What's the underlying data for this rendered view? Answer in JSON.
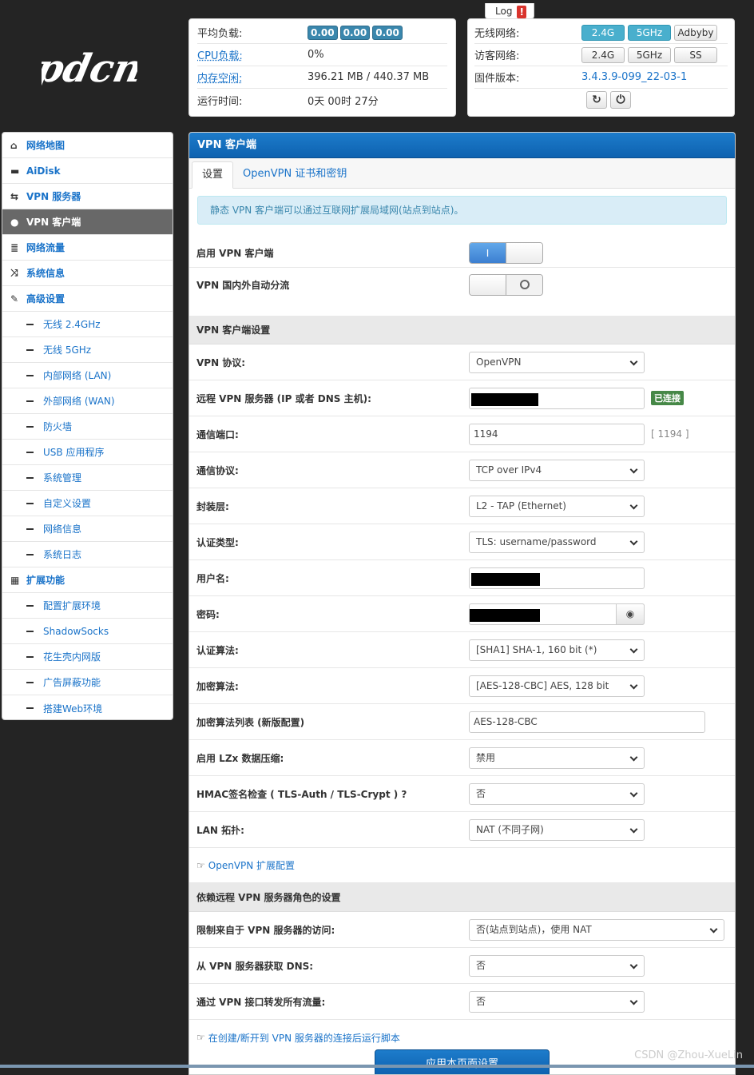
{
  "logo": {
    "text": "pdcn"
  },
  "log_tab": {
    "label": "Log",
    "warn": "!"
  },
  "status": {
    "load_label": "平均负载:",
    "load_values": [
      "0.00",
      "0.00",
      "0.00"
    ],
    "cpu_label": "CPU负载:",
    "cpu_value": "0%",
    "mem_label": "内存空闲:",
    "mem_value": "396.21 MB / 440.37 MB",
    "uptime_label": "运行时间:",
    "uptime_value": "0天 00时 27分"
  },
  "wifi": {
    "wireless_label": "无线网络:",
    "wireless_buttons": [
      "2.4G",
      "5GHz",
      "Adbyby"
    ],
    "guest_label": "访客网络:",
    "guest_buttons": [
      "2.4G",
      "5GHz",
      "SS"
    ],
    "firmware_label": "固件版本:",
    "firmware_value": "3.4.3.9-099_22-03-1"
  },
  "sidebar": {
    "items": [
      {
        "label": "网络地图",
        "icon": "home-icon",
        "glyph": "⌂"
      },
      {
        "label": "AiDisk",
        "icon": "hdd-icon",
        "glyph": "▬"
      },
      {
        "label": "VPN 服务器",
        "icon": "retweet-icon",
        "glyph": "⇆"
      },
      {
        "label": "VPN 客户端",
        "icon": "globe-icon",
        "glyph": "●",
        "active": true
      },
      {
        "label": "网络流量",
        "icon": "list-icon",
        "glyph": "≣"
      },
      {
        "label": "系统信息",
        "icon": "random-icon",
        "glyph": "⤨"
      },
      {
        "label": "高级设置",
        "icon": "wrench-icon",
        "glyph": "✎"
      }
    ],
    "advanced_sub": [
      "无线 2.4GHz",
      "无线 5GHz",
      "内部网络 (LAN)",
      "外部网络 (WAN)",
      "防火墙",
      "USB 应用程序",
      "系统管理",
      "自定义设置",
      "网络信息",
      "系统日志"
    ],
    "ext_label": "扩展功能",
    "ext_sub": [
      "配置扩展环境",
      "ShadowSocks",
      "花生壳内网版",
      "广告屏蔽功能",
      "搭建Web环境"
    ]
  },
  "main": {
    "title": "VPN 客户端",
    "tabs": [
      "设置",
      "OpenVPN 证书和密钥"
    ],
    "info": "静态 VPN 客户端可以通过互联网扩展局域网(站点到站点)。",
    "enable_label": "启用 VPN 客户端",
    "enable_on_text": "I",
    "auto_split_label": "VPN 国内外自动分流",
    "section1": "VPN 客户端设置",
    "rows": {
      "protocol": {
        "label": "VPN 协议:",
        "value": "OpenVPN"
      },
      "server": {
        "label": "远程 VPN 服务器 (IP 或者 DNS 主机):",
        "status": "已连接"
      },
      "port": {
        "label": "通信端口:",
        "value": "1194",
        "hint": "[ 1194 ]"
      },
      "transport": {
        "label": "通信协议:",
        "value": "TCP over IPv4"
      },
      "encap": {
        "label": "封装层:",
        "value": "L2 - TAP (Ethernet)"
      },
      "auth_type": {
        "label": "认证类型:",
        "value": "TLS: username/password"
      },
      "username": {
        "label": "用户名:"
      },
      "password": {
        "label": "密码:"
      },
      "auth_alg": {
        "label": "认证算法:",
        "value": "[SHA1] SHA-1, 160 bit (*)"
      },
      "cipher": {
        "label": "加密算法:",
        "value": "[AES-128-CBC] AES, 128 bit"
      },
      "cipher_list": {
        "label": "加密算法列表 (新版配置)",
        "value": "AES-128-CBC"
      },
      "lzx": {
        "label": "启用 LZx 数据压缩:",
        "value": "禁用"
      },
      "hmac": {
        "label": "HMAC签名检查 ( TLS-Auth / TLS-Crypt ) ?",
        "value": "否"
      },
      "lan_topo": {
        "label": "LAN 拓扑:",
        "value": "NAT (不同子网)"
      }
    },
    "ext_config_link": "OpenVPN 扩展配置",
    "section2": "依赖远程 VPN 服务器角色的设置",
    "rows2": {
      "restrict": {
        "label": "限制来自于 VPN 服务器的访问:",
        "value": "否(站点到站点)，使用 NAT"
      },
      "dns": {
        "label": "从 VPN 服务器获取 DNS:",
        "value": "否"
      },
      "forward_all": {
        "label": "通过 VPN 接口转发所有流量:",
        "value": "否"
      }
    },
    "script_link": "在创建/断开到 VPN 服务器的连接后运行脚本",
    "apply_label": "应用本页面设置"
  },
  "watermark": "CSDN @Zhou-XueLin",
  "colors": {
    "accent": "#1a73c9",
    "header_blue": "#0e62b0",
    "badge_blue": "#3a87ad",
    "connected_green": "#468847",
    "sidebar_active": "#686868"
  }
}
